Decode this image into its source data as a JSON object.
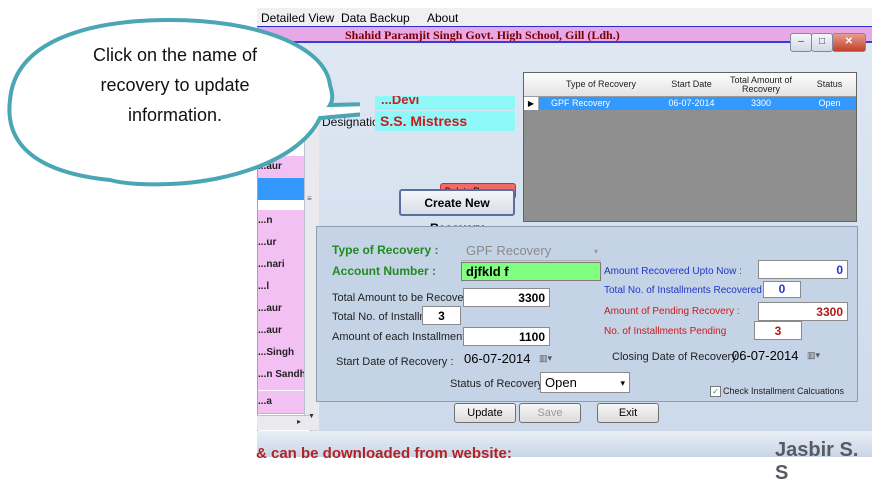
{
  "menu": {
    "items": [
      "Detailed View",
      "Data Backup",
      "About"
    ]
  },
  "window": {
    "title": "Shahid Paramjit Singh Govt. High School, Gill (Ldh.)"
  },
  "callout": {
    "text": "Click on the name of recovery to update information."
  },
  "employee": {
    "name_fragment": "...Devi",
    "designation_label": "Designation",
    "designation_value": "S.S. Mistress"
  },
  "left_list": {
    "items": [
      "...aur",
      "",
      "",
      "...n",
      "...ur",
      "...nari",
      "...l",
      "...aur",
      "...aur",
      "...Singh",
      "...n Sandhu",
      "",
      "...a"
    ]
  },
  "buttons": {
    "delete_recovery": "Delete Recovery >>",
    "create_new_recovery": "Create New Recovery",
    "update": "Update",
    "save": "Save",
    "exit": "Exit"
  },
  "grid": {
    "columns": [
      "Type of Recovery",
      "Start Date",
      "Total Amount of Recovery",
      "Status"
    ],
    "rows": [
      {
        "type": "GPF Recovery",
        "start_date": "06-07-2014",
        "total": "3300",
        "status": "Open"
      }
    ]
  },
  "form": {
    "type_of_recovery_label": "Type of Recovery :",
    "type_of_recovery_value": "GPF Recovery",
    "account_number_label": "Account Number :",
    "account_number_value": "djfkld f",
    "total_amount_label": "Total Amount to be Recovered :",
    "total_amount_value": "3300",
    "total_installments_label": "Total No. of Installments",
    "total_installments_value": "3",
    "amount_each_label": "Amount of each Installment.",
    "amount_each_value": "1100",
    "start_date_label": "Start Date of Recovery :",
    "start_date_value": "06-07-2014",
    "status_label": "Status of Recovery :",
    "status_value": "Open",
    "amount_recovered_label": "Amount Recovered Upto Now :",
    "amount_recovered_value": "0",
    "installments_recovered_label": "Total No. of Installments Recovered",
    "installments_recovered_value": "0",
    "pending_amount_label": "Amount of Pending Recovery :",
    "pending_amount_value": "3300",
    "pending_installments_label": "No. of Installments Pending",
    "pending_installments_value": "3",
    "closing_date_label": "Closing Date of Recovery :",
    "closing_date_value": "06-07-2014",
    "check_installment_label": "Check Installment Calcuations"
  },
  "footer": {
    "left_text": "& can be downloaded from website:",
    "right_text": "Jasbir S. S"
  },
  "colors": {
    "accent_blue": "#3399ff",
    "pink": "#f3c0f3",
    "cyan": "#8ff8f8",
    "green": "#80ff80",
    "callout_border": "#4aa6b4"
  }
}
